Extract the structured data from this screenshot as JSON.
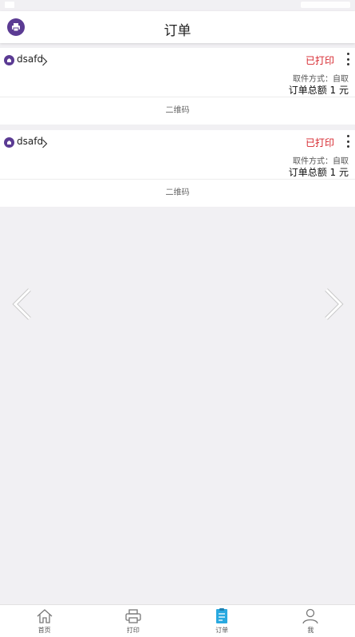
{
  "header": {
    "title": "订单",
    "logo_icon": "printer-icon"
  },
  "orders": [
    {
      "store_name": "dsafd",
      "status": "已打印",
      "pickup_method": "取件方式：自取",
      "total": "订单总额 1 元",
      "qr_label": "二维码"
    },
    {
      "store_name": "dsafd",
      "status": "已打印",
      "pickup_method": "取件方式：自取",
      "total": "订单总额 1 元",
      "qr_label": "二维码"
    }
  ],
  "tabbar": {
    "items": [
      {
        "label": "首页",
        "icon": "home-icon"
      },
      {
        "label": "打印",
        "icon": "printer-icon"
      },
      {
        "label": "订单",
        "icon": "order-icon",
        "active": true
      },
      {
        "label": "我",
        "icon": "user-icon"
      }
    ]
  },
  "colors": {
    "brand": "#5b3b93",
    "status_printed": "#d6262d",
    "active_tab": "#29a9e0",
    "background": "#f1f0f3"
  }
}
